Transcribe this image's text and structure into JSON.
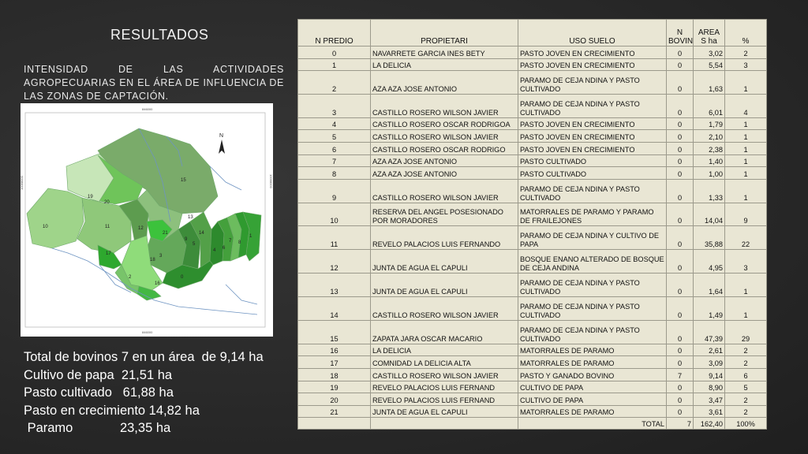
{
  "slide": {
    "title": "RESULTADOS",
    "subtitle": "INTENSIDAD DE LAS ACTIVIDADES AGROPECUARIAS EN EL ÁREA DE INFLUENCIA DE LAS ZONAS DE CAPTACIÓN."
  },
  "map": {
    "north_label": "N",
    "coord_top": "846000",
    "coord_bottom": "846000",
    "coord_left": "10068000",
    "coord_right": "10068000",
    "parcel_labels": [
      "0",
      "1",
      "2",
      "3",
      "4",
      "5",
      "6",
      "7",
      "8",
      "9",
      "10",
      "11",
      "12",
      "13",
      "14",
      "15",
      "16",
      "17",
      "18",
      "19",
      "20",
      "21"
    ]
  },
  "summary": [
    "Total de bovinos 7 en un área  de 9,14 ha",
    "Cultivo de papa  21,51 ha",
    "Pasto cultivado   61,88 ha",
    "Pasto en crecimiento 14,82 ha",
    " Paramo             23,35 ha"
  ],
  "table": {
    "headers": {
      "predio": "N PREDIO",
      "propietario": "PROPIETARI",
      "uso": "USO SUELO",
      "bovino": "N BOVINO",
      "area": "AREA S ha",
      "pct": "%"
    },
    "rows": [
      {
        "n": "0",
        "prop": "NAVARRETE GARCIA INES BETY",
        "uso": "PASTO JOVEN EN CRECIMIENTO",
        "bov": "0",
        "area": "3,02",
        "pct": "2"
      },
      {
        "n": "1",
        "prop": "LA DELICIA",
        "uso": "PASTO JOVEN EN CRECIMIENTO",
        "bov": "0",
        "area": "5,54",
        "pct": "3"
      },
      {
        "n": "2",
        "prop": "AZA  AZA  JOSE  ANTONIO",
        "uso": "PARAMO DE CEJA NDINA Y PASTO CULTIVADO",
        "bov": "0",
        "area": "1,63",
        "pct": "1"
      },
      {
        "n": "3",
        "prop": "CASTILLO ROSERO WILSON JAVIER",
        "uso": "PARAMO DE CEJA NDINA Y PASTO CULTIVADO",
        "bov": "0",
        "area": "6,01",
        "pct": "4"
      },
      {
        "n": "4",
        "prop": "CASTILLO ROSERO  OSCAR RODRIGOA",
        "uso": "PASTO JOVEN EN CRECIMIENTO",
        "bov": "0",
        "area": "1,79",
        "pct": "1"
      },
      {
        "n": "5",
        "prop": "CASTILLO ROSERO WILSON JAVIER",
        "uso": "PASTO JOVEN EN CRECIMIENTO",
        "bov": "0",
        "area": "2,10",
        "pct": "1"
      },
      {
        "n": "6",
        "prop": "CASTILLO ROSERO  OSCAR RODRIGO",
        "uso": "PASTO JOVEN EN CRECIMIENTO",
        "bov": "0",
        "area": "2,38",
        "pct": "1"
      },
      {
        "n": "7",
        "prop": "AZA  AZA  JOSE  ANTONIO",
        "uso": "PASTO CULTIVADO",
        "bov": "0",
        "area": "1,40",
        "pct": "1"
      },
      {
        "n": "8",
        "prop": "AZA  AZA  JOSE  ANTONIO",
        "uso": "PASTO CULTIVADO",
        "bov": "0",
        "area": "1,00",
        "pct": "1"
      },
      {
        "n": "9",
        "prop": "CASTILLO ROSERO WILSON JAVIER",
        "uso": "PARAMO DE CEJA NDINA Y PASTO CULTIVADO",
        "bov": "0",
        "area": "1,33",
        "pct": "1"
      },
      {
        "n": "10",
        "prop": "RESERVA  DEL ANGEL  POSESIONADO POR  MORADORES",
        "uso": "MATORRALES DE PARAMO Y PARAMO DE FRAILEJONES",
        "bov": "0",
        "area": "14,04",
        "pct": "9"
      },
      {
        "n": "11",
        "prop": "REVELO PALACIOS LUIS FERNANDO",
        "uso": "PARAMO DE CEJA NDINA Y CULTIVO DE PAPA",
        "bov": "0",
        "area": "35,88",
        "pct": "22"
      },
      {
        "n": "12",
        "prop": "JUNTA DE AGUA EL CAPULI",
        "uso": "BOSQUE ENANO ALTERADO DE BOSQUE DE CEJA ANDINA",
        "bov": "0",
        "area": "4,95",
        "pct": "3"
      },
      {
        "n": "13",
        "prop": "JUNTA DE AGUA EL CAPULI",
        "uso": "PARAMO DE CEJA NDINA Y PASTO CULTIVADO",
        "bov": "0",
        "area": "1,64",
        "pct": "1"
      },
      {
        "n": "14",
        "prop": "CASTILLO ROSERO WILSON JAVIER",
        "uso": "PARAMO DE CEJA NDINA Y PASTO CULTIVADO",
        "bov": "0",
        "area": "1,49",
        "pct": "1"
      },
      {
        "n": "15",
        "prop": "ZAPATA JARA OSCAR MACARIO",
        "uso": "PARAMO DE CEJA NDINA Y PASTO CULTIVADO",
        "bov": "0",
        "area": "47,39",
        "pct": "29"
      },
      {
        "n": "16",
        "prop": "LA DELICIA",
        "uso": "MATORRALES DE PARAMO",
        "bov": "0",
        "area": "2,61",
        "pct": "2"
      },
      {
        "n": "17",
        "prop": "COMNIDAD LA DELICIA ALTA",
        "uso": "MATORRALES DE PARAMO",
        "bov": "0",
        "area": "3,09",
        "pct": "2"
      },
      {
        "n": "18",
        "prop": "CASTILLO ROSERO WILSON JAVIER",
        "uso": "PASTO  Y GANADO BOVINO",
        "bov": "7",
        "area": "9,14",
        "pct": "6"
      },
      {
        "n": "19",
        "prop": "REVELO PALACIOS LUIS FERNAND",
        "uso": "CULTIVO DE PAPA",
        "bov": "0",
        "area": "8,90",
        "pct": "5"
      },
      {
        "n": "20",
        "prop": "REVELO PALACIOS LUIS FERNAND",
        "uso": "CULTIVO DE PAPA",
        "bov": "0",
        "area": "3,47",
        "pct": "2"
      },
      {
        "n": "21",
        "prop": "JUNTA DE AGUA EL CAPULI",
        "uso": "MATORRALES DE PARAMO",
        "bov": "0",
        "area": "3,61",
        "pct": "2"
      }
    ],
    "total": {
      "label": "TOTAL",
      "bov": "7",
      "area": "162,40",
      "pct": "100%"
    }
  },
  "colors": {
    "background": "#2b2b2b",
    "table_bg": "#e9e6d4",
    "table_border": "#9c9a8c",
    "map_dark_green": "#2f9a2f",
    "map_mid_green": "#7cbf6a",
    "map_light_green": "#a9d99a"
  }
}
